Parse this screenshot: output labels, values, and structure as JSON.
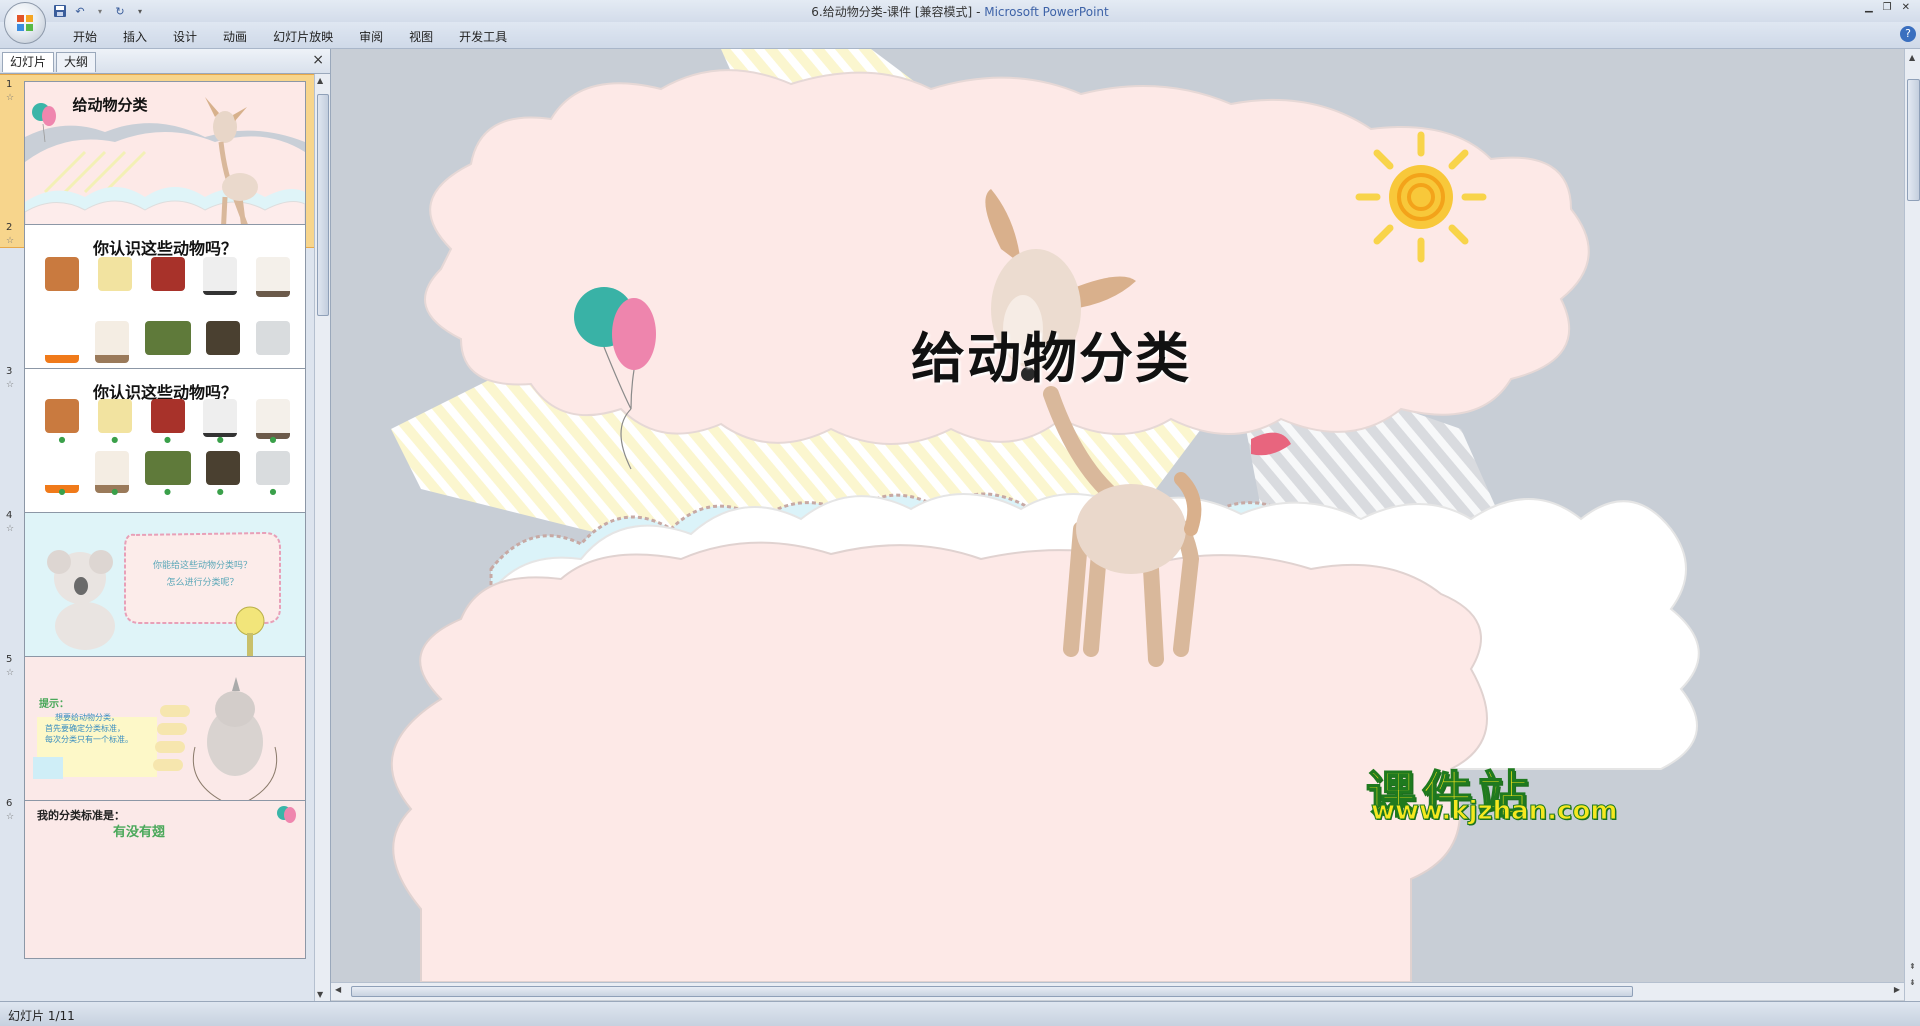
{
  "window": {
    "doc_name": "6.给动物分类-课件 [兼容模式]",
    "separator": " - ",
    "app_name": "Microsoft PowerPoint"
  },
  "ribbon": {
    "tabs": [
      "开始",
      "插入",
      "设计",
      "动画",
      "幻灯片放映",
      "审阅",
      "视图",
      "开发工具"
    ]
  },
  "left_pane": {
    "tab_slides": "幻灯片",
    "tab_outline": "大纲",
    "close": "×",
    "slides": [
      {
        "num": "1",
        "title": "给动物分类"
      },
      {
        "num": "2",
        "title": "你认识这些动物吗？"
      },
      {
        "num": "3",
        "title": "你认识这些动物吗？"
      },
      {
        "num": "4",
        "line1": "你能给这些动物分类吗？",
        "line2": "怎么进行分类呢？"
      },
      {
        "num": "5",
        "hint": "提示：",
        "text1": "想要给动物分类，",
        "text2": "首先要确定分类标准，",
        "text3": "每次分类只有一个标准。"
      },
      {
        "num": "6",
        "title": "我的分类标准是：",
        "sub": "有没有翅"
      }
    ]
  },
  "slide": {
    "title": "给动物分类"
  },
  "status": {
    "text": "幻灯片 1/11"
  },
  "watermark": {
    "main": "课件站",
    "url": "www.kjzhan.com"
  }
}
